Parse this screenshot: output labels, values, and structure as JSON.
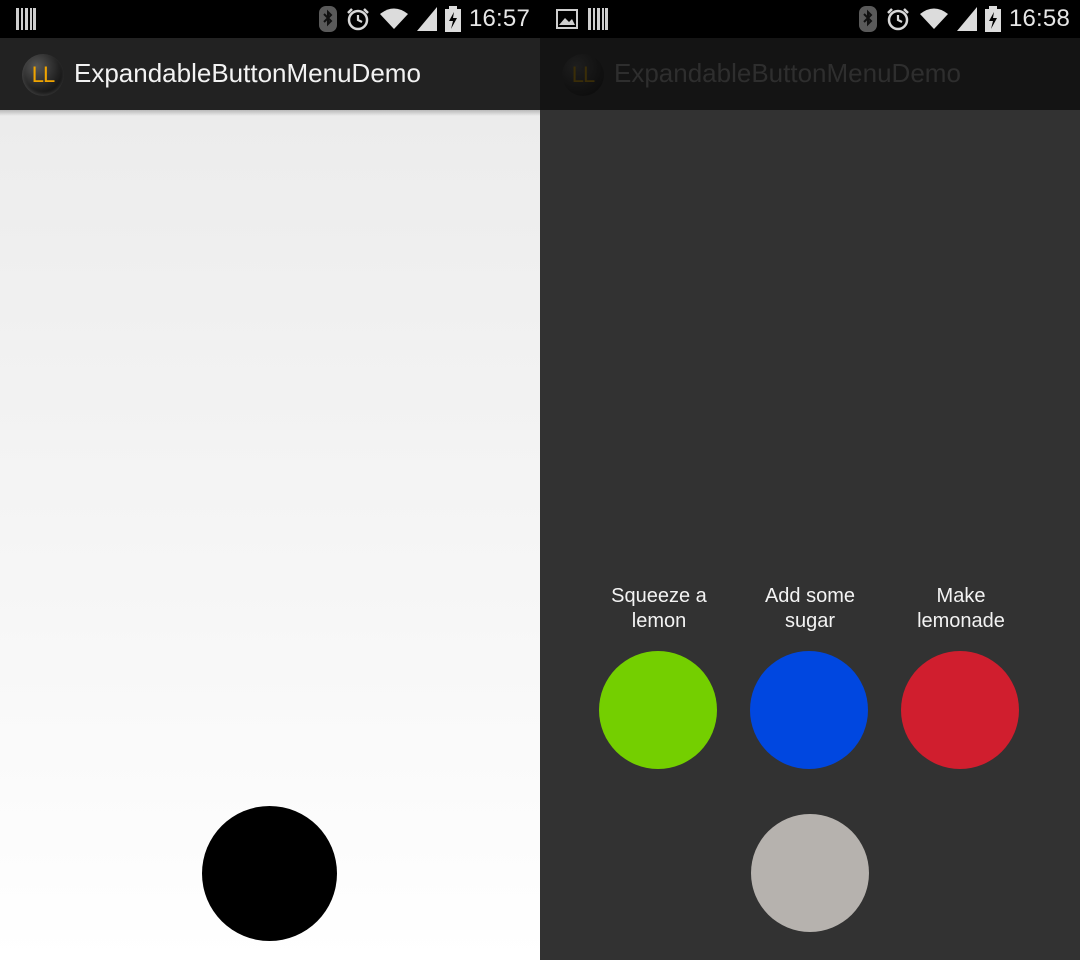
{
  "left_screen": {
    "status_bar": {
      "time": "16:57"
    },
    "action_bar": {
      "icon_text": "LL",
      "title": "ExpandableButtonMenuDemo"
    },
    "main_button": {
      "color": "#000000",
      "state": "collapsed"
    }
  },
  "right_screen": {
    "status_bar": {
      "time": "16:58"
    },
    "action_bar": {
      "icon_text": "LL",
      "title": "ExpandableButtonMenuDemo"
    },
    "menu_items": [
      {
        "label_line1": "Squeeze a",
        "label_line2": "lemon",
        "color": "#74cf00"
      },
      {
        "label_line1": "Add some",
        "label_line2": "sugar",
        "color": "#0047e0"
      },
      {
        "label_line1": "Make",
        "label_line2": "lemonade",
        "color": "#d01e2e"
      }
    ],
    "close_button": {
      "color": "#b6b2ae",
      "state": "expanded"
    }
  }
}
